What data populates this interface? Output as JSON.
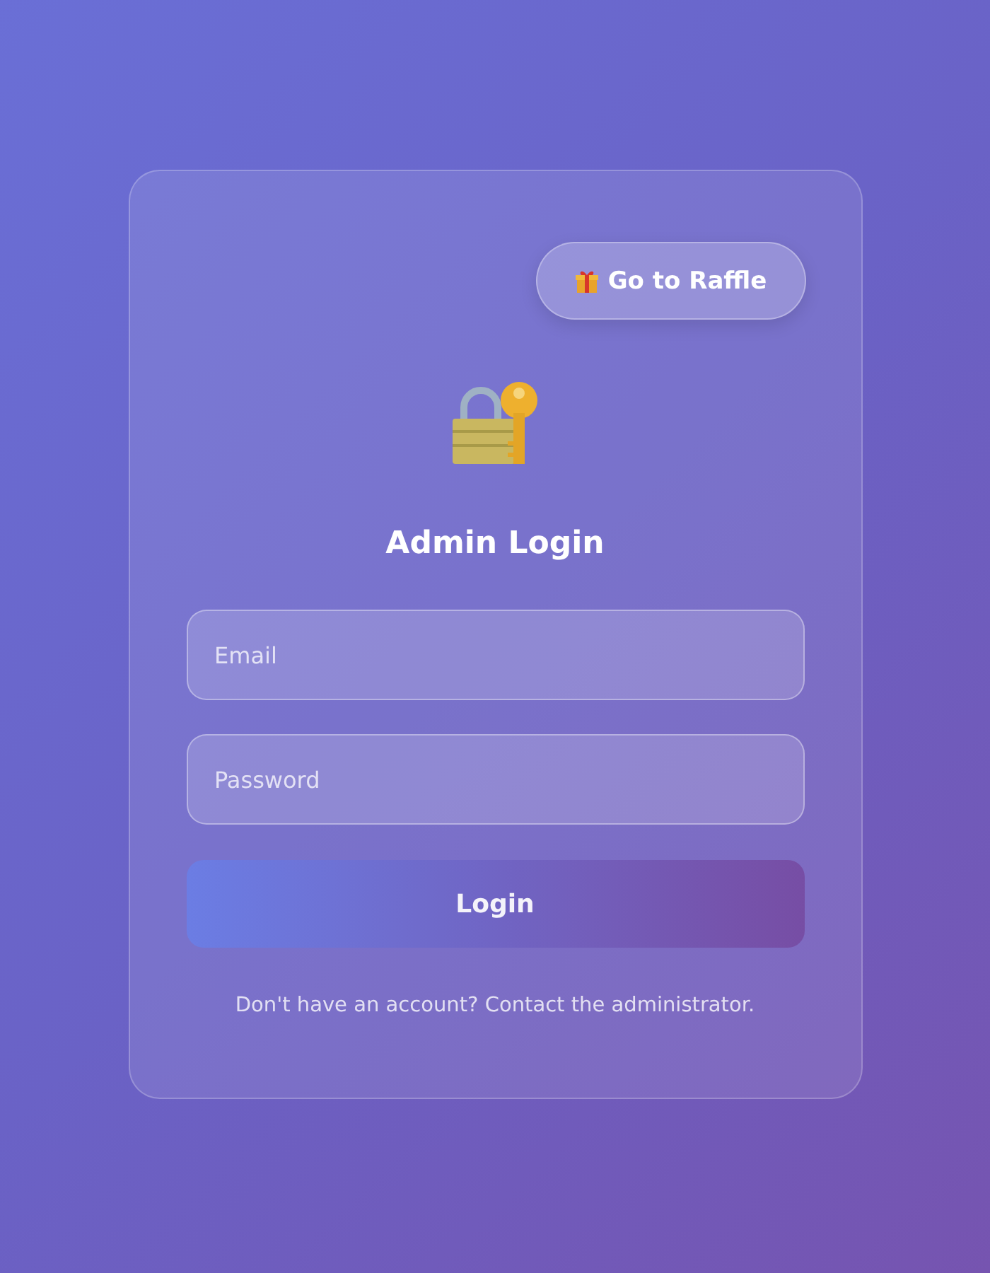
{
  "raffle_button": {
    "label": "Go to Raffle"
  },
  "title": "Admin Login",
  "fields": [
    {
      "placeholder": "Email"
    },
    {
      "placeholder": "Password"
    }
  ],
  "login_button": {
    "label": "Login"
  },
  "footer": "Don't have an account? Contact the administrator."
}
